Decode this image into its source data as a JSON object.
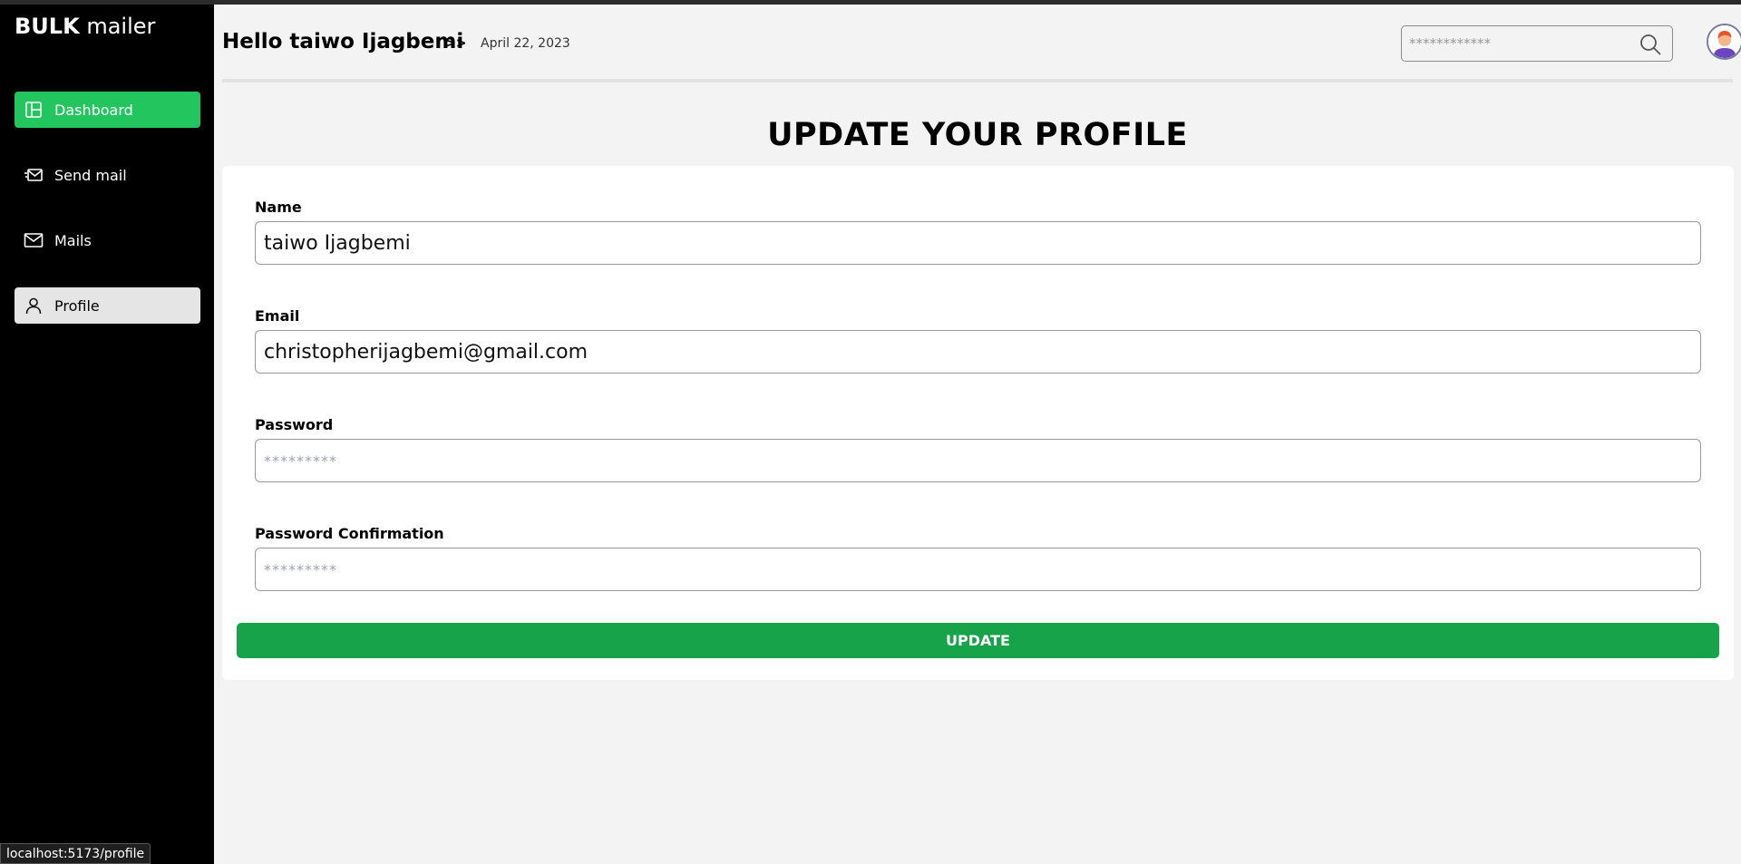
{
  "app": {
    "logo_bold": "BULK",
    "logo_light": "mailer",
    "url": "localhost:5173/profile"
  },
  "sidebar": {
    "items": [
      {
        "label": "Dashboard",
        "icon": "layout-icon"
      },
      {
        "label": "Send mail",
        "icon": "send-mail-icon"
      },
      {
        "label": "Mails",
        "icon": "envelope-icon"
      },
      {
        "label": "Profile",
        "icon": "user-icon"
      }
    ]
  },
  "header": {
    "greeting": "Hello taiwo Ijagbemi",
    "separator": ">>",
    "date": "April 22, 2023",
    "search_placeholder": "************"
  },
  "form": {
    "title": "UPDATE YOUR PROFILE",
    "name_label": "Name",
    "name_value": "taiwo Ijagbemi",
    "email_label": "Email",
    "email_value": "christopherijagbemi@gmail.com",
    "password_label": "Password",
    "password_placeholder": "*********",
    "password_confirm_label": "Password Confirmation",
    "password_confirm_placeholder": "*********",
    "submit_label": "UPDATE"
  },
  "colors": {
    "accent": "#22c55e",
    "button": "#16a34a",
    "sidebar": "#000000",
    "background": "#f3f3f3"
  }
}
